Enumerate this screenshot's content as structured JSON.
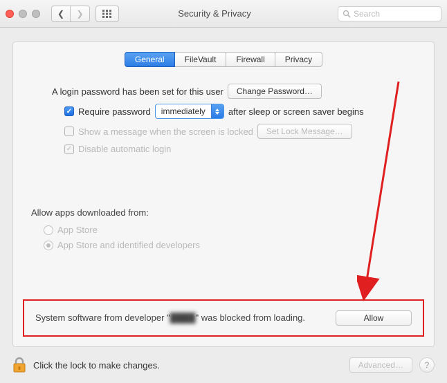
{
  "titlebar": {
    "title": "Security & Privacy",
    "search_placeholder": "Search"
  },
  "tabs": {
    "general": "General",
    "filevault": "FileVault",
    "firewall": "Firewall",
    "privacy": "Privacy"
  },
  "login": {
    "password_set": "A login password has been set for this user",
    "change_password": "Change Password…",
    "require_password_label": "Require password",
    "require_password_value": "immediately",
    "after_sleep": "after sleep or screen saver begins",
    "show_message_label": "Show a message when the screen is locked",
    "set_lock_message": "Set Lock Message…",
    "disable_auto_login": "Disable automatic login"
  },
  "download": {
    "title": "Allow apps downloaded from:",
    "opt1": "App Store",
    "opt2": "App Store and identified developers"
  },
  "blocked": {
    "prefix": "System software from developer \"",
    "redacted": "████",
    "suffix": "\" was blocked from loading.",
    "allow": "Allow"
  },
  "footer": {
    "lock_text": "Click the lock to make changes.",
    "advanced": "Advanced…",
    "help": "?"
  }
}
